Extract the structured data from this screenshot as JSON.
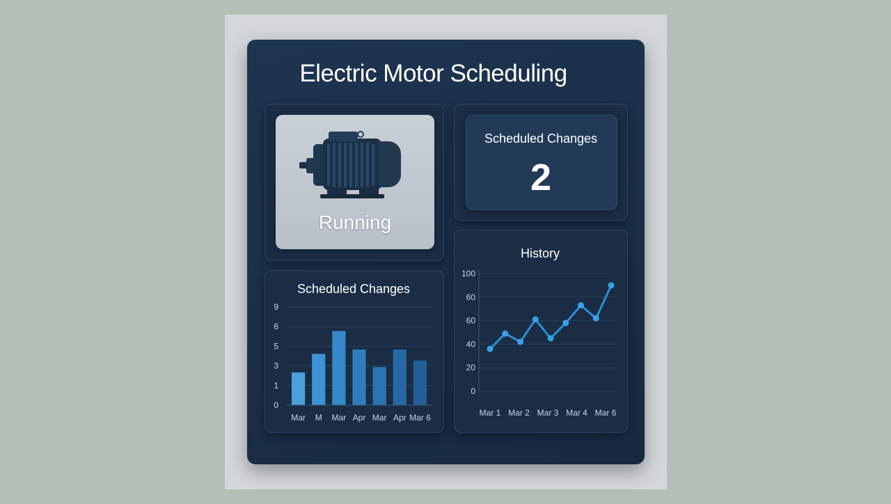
{
  "dashboard": {
    "title": "Electric Motor Scheduling"
  },
  "motor_status": {
    "label": "Running",
    "icon": "electric-motor-icon"
  },
  "scheduled_changes": {
    "label": "Scheduled Changes",
    "value": "2"
  },
  "colors": {
    "background": "#172a40",
    "bar": "#3b8fce",
    "line": "#2b8fd8"
  },
  "chart_data": [
    {
      "type": "bar",
      "title": "Scheduled Changes",
      "categories": [
        "Mar",
        "M",
        "Mar",
        "Apr",
        "Mar",
        "Apr",
        "Mar 6"
      ],
      "values": [
        3,
        4.7,
        6.8,
        5.1,
        3.5,
        5.1,
        4.1
      ],
      "y_ticks": [
        "0",
        "1",
        "3",
        "5",
        "6",
        "9"
      ],
      "ylim": [
        0,
        9
      ],
      "grid": true
    },
    {
      "type": "line",
      "title": "History",
      "x_ticks": [
        "Mar 1",
        "Mar 2",
        "Mar 3",
        "Mar 4",
        "Mar 6"
      ],
      "y_ticks": [
        "0",
        "20",
        "40",
        "60",
        "60",
        "100"
      ],
      "values": [
        36,
        49,
        42,
        61,
        45,
        58,
        73,
        62,
        90
      ],
      "ylim": [
        0,
        100
      ],
      "grid": true
    }
  ]
}
